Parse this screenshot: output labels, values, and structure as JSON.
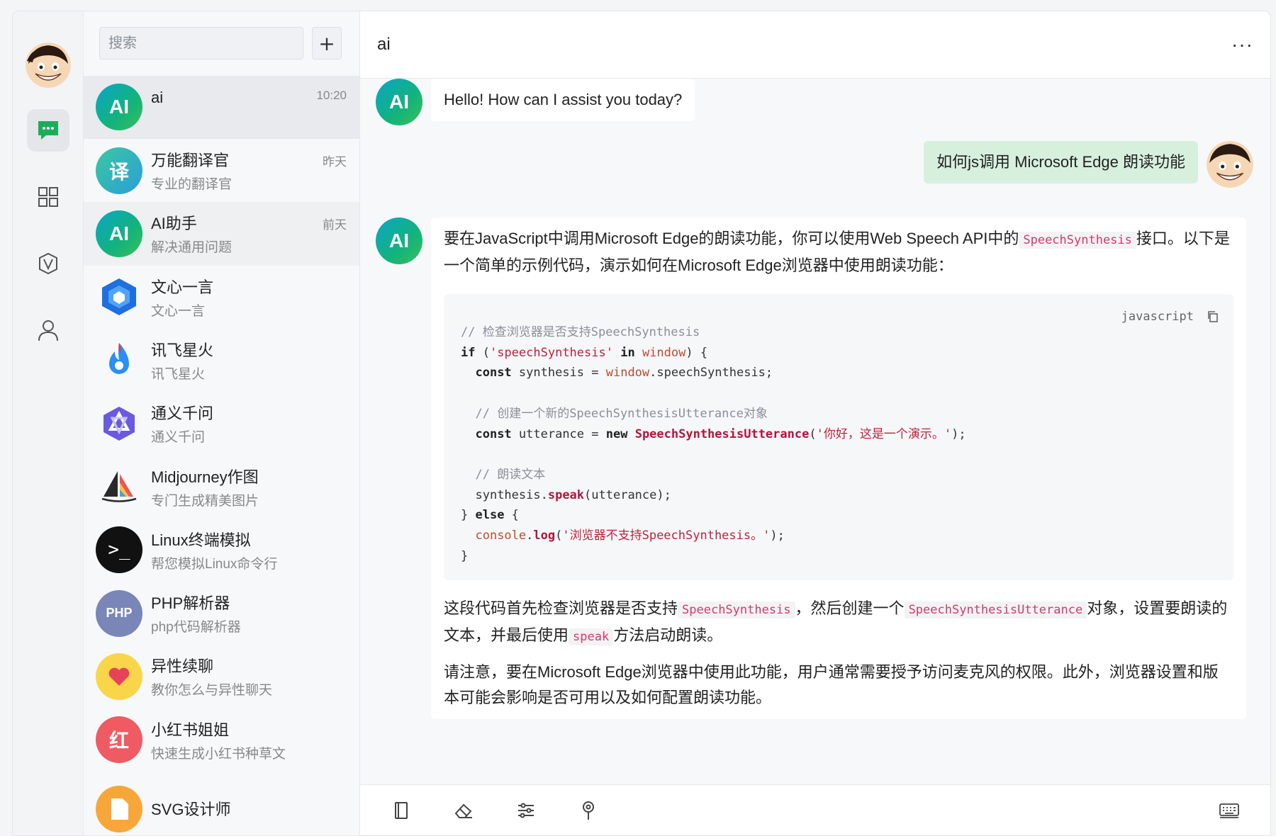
{
  "rail": {
    "items": [
      {
        "name": "chat",
        "active": true
      },
      {
        "name": "apps"
      },
      {
        "name": "plugins"
      },
      {
        "name": "profile"
      }
    ]
  },
  "search": {
    "placeholder": "搜索"
  },
  "list": {
    "add_label": "+",
    "chats": [
      {
        "title": "ai",
        "subtitle": "",
        "time": "10:20",
        "avatar_text": "AI"
      },
      {
        "title": "万能翻译官",
        "subtitle": "专业的翻译官",
        "time": "昨天",
        "avatar_text": "译"
      },
      {
        "title": "AI助手",
        "subtitle": "解决通用问题",
        "time": "前天",
        "avatar_text": "AI"
      },
      {
        "title": "文心一言",
        "subtitle": "文心一言",
        "time": "",
        "avatar_text": ""
      },
      {
        "title": "讯飞星火",
        "subtitle": "讯飞星火",
        "time": "",
        "avatar_text": ""
      },
      {
        "title": "通义千问",
        "subtitle": "通义千问",
        "time": "",
        "avatar_text": ""
      },
      {
        "title": "Midjourney作图",
        "subtitle": "专门生成精美图片",
        "time": "",
        "avatar_text": ""
      },
      {
        "title": "Linux终端模拟",
        "subtitle": "帮您模拟Linux命令行",
        "time": "",
        "avatar_text": ">_"
      },
      {
        "title": "PHP解析器",
        "subtitle": "php代码解析器",
        "time": "",
        "avatar_text": "PHP"
      },
      {
        "title": "异性续聊",
        "subtitle": "教你怎么与异性聊天",
        "time": "",
        "avatar_text": ""
      },
      {
        "title": "小红书姐姐",
        "subtitle": "快速生成小红书种草文",
        "time": "",
        "avatar_text": "红"
      },
      {
        "title": "SVG设计师",
        "subtitle": "",
        "time": "",
        "avatar_text": ""
      }
    ]
  },
  "header": {
    "title": "ai",
    "more": "···"
  },
  "messages": {
    "ai_avatar": "AI",
    "m1": "Hello! How can I assist you today?",
    "m2": "如何js调用 Microsoft Edge 朗读功能",
    "m3_p1a": "要在JavaScript中调用Microsoft Edge的朗读功能，你可以使用Web Speech API中的",
    "m3_code1": "SpeechSynthesis",
    "m3_p1b": "接口。以下是一个简单的示例代码，演示如何在Microsoft Edge浏览器中使用朗读功能：",
    "code_lang": "javascript",
    "code": {
      "l1": "// 检查浏览器是否支持SpeechSynthesis",
      "if_kw": "if",
      "str1": "'speechSynthesis'",
      "in_kw": "in",
      "window": "window",
      "const_kw": "const",
      "l3_var": " synthesis = ",
      "l3_prop": ".speechSynthesis;",
      "l5": "// 创建一个新的SpeechSynthesisUtterance对象",
      "l6_var": " utterance = ",
      "new_kw": "new",
      "utter_cls": "SpeechSynthesisUtterance",
      "str2": "'你好，这是一个演示。'",
      "l8": "// 朗读文本",
      "l9a": "synthesis.",
      "speak": "speak",
      "l9b": "(utterance);",
      "else_kw": "else",
      "console": "console",
      "log": "log",
      "str3": "'浏览器不支持SpeechSynthesis。'"
    },
    "m3_p2a": "这段代码首先检查浏览器是否支持",
    "m3_code2": "SpeechSynthesis",
    "m3_p2b": "，然后创建一个",
    "m3_code3": "SpeechSynthesisUtterance",
    "m3_p2c": "对象，设置要朗读的文本，并最后使用",
    "m3_code4": "speak",
    "m3_p2d": "方法启动朗读。",
    "m3_p3": "请注意，要在Microsoft Edge浏览器中使用此功能，用户通常需要授予访问麦克风的权限。此外，浏览器设置和版本可能会影响是否可用以及如何配置朗读功能。"
  },
  "footer": {
    "tools": [
      "book-icon",
      "eraser-icon",
      "sliders-icon",
      "pin-icon",
      "keyboard-icon"
    ]
  }
}
